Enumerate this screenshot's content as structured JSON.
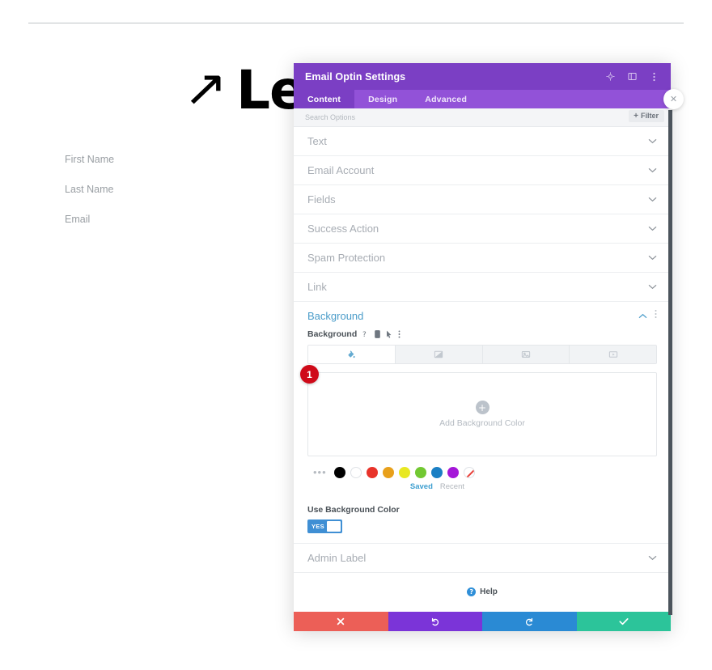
{
  "page": {
    "hero_arrow": "↗",
    "hero_word": "Lea",
    "form_labels": [
      "First Name",
      "Last Name",
      "Email"
    ]
  },
  "modal": {
    "title": "Email Optin Settings",
    "header_icons": [
      {
        "name": "target-icon",
        "label": "target"
      },
      {
        "name": "layout-icon",
        "label": "layout"
      },
      {
        "name": "vertical-dots-icon",
        "label": "more options"
      }
    ],
    "tabs": [
      {
        "label": "Content",
        "active": true
      },
      {
        "label": "Design",
        "active": false
      },
      {
        "label": "Advanced",
        "active": false
      }
    ],
    "search": {
      "placeholder": "Search Options",
      "filter_label": "Filter",
      "filter_plus": "+"
    },
    "sections": [
      {
        "label": "Text",
        "open": false
      },
      {
        "label": "Email Account",
        "open": false
      },
      {
        "label": "Fields",
        "open": false
      },
      {
        "label": "Success Action",
        "open": false
      },
      {
        "label": "Spam Protection",
        "open": false
      },
      {
        "label": "Link",
        "open": false
      }
    ],
    "background": {
      "section_title": "Background",
      "field_label": "Background",
      "field_icons": [
        "help-question-icon",
        "mobile-icon",
        "cursor-icon",
        "vertical-dots-icon"
      ],
      "type_tabs": [
        {
          "name": "background-color-tab",
          "label": "Color",
          "active": true
        },
        {
          "name": "background-gradient-tab",
          "label": "Gradient",
          "active": false
        },
        {
          "name": "background-image-tab",
          "label": "Image",
          "active": false
        },
        {
          "name": "background-video-tab",
          "label": "Video",
          "active": false
        }
      ],
      "canvas": {
        "add_label": "Add Background Color",
        "plus": "+"
      },
      "swatches": [
        {
          "name": "swatch-more",
          "color": "",
          "glyph": "•••"
        },
        {
          "name": "swatch-black",
          "color": "#000000"
        },
        {
          "name": "swatch-white",
          "color": "#ffffff"
        },
        {
          "name": "swatch-red",
          "color": "#e8332a"
        },
        {
          "name": "swatch-orange",
          "color": "#e8a01b"
        },
        {
          "name": "swatch-yellow",
          "color": "#e8e822"
        },
        {
          "name": "swatch-green",
          "color": "#72c832"
        },
        {
          "name": "swatch-blue",
          "color": "#1b7fc4"
        },
        {
          "name": "swatch-purple",
          "color": "#a417d8"
        },
        {
          "name": "swatch-custom",
          "color": "#ffffff"
        }
      ],
      "palette_tabs": [
        {
          "label": "Saved",
          "active": true
        },
        {
          "label": "Recent",
          "active": false
        }
      ],
      "toggle": {
        "label": "Use Background Color",
        "state": "YES"
      }
    },
    "admin_label": {
      "label": "Admin Label",
      "open": false
    },
    "help": {
      "label": "Help",
      "glyph": "?"
    },
    "footer": [
      {
        "name": "cancel-button",
        "glyph": "✖",
        "color": "#ec5f57"
      },
      {
        "name": "undo-button",
        "glyph": "↺",
        "color": "#7b34d8"
      },
      {
        "name": "redo-button",
        "glyph": "↻",
        "color": "#2a8ad4"
      },
      {
        "name": "save-button",
        "glyph": "✔",
        "color": "#2cc49a"
      }
    ],
    "close_label": "✕",
    "step_badge": "1"
  }
}
